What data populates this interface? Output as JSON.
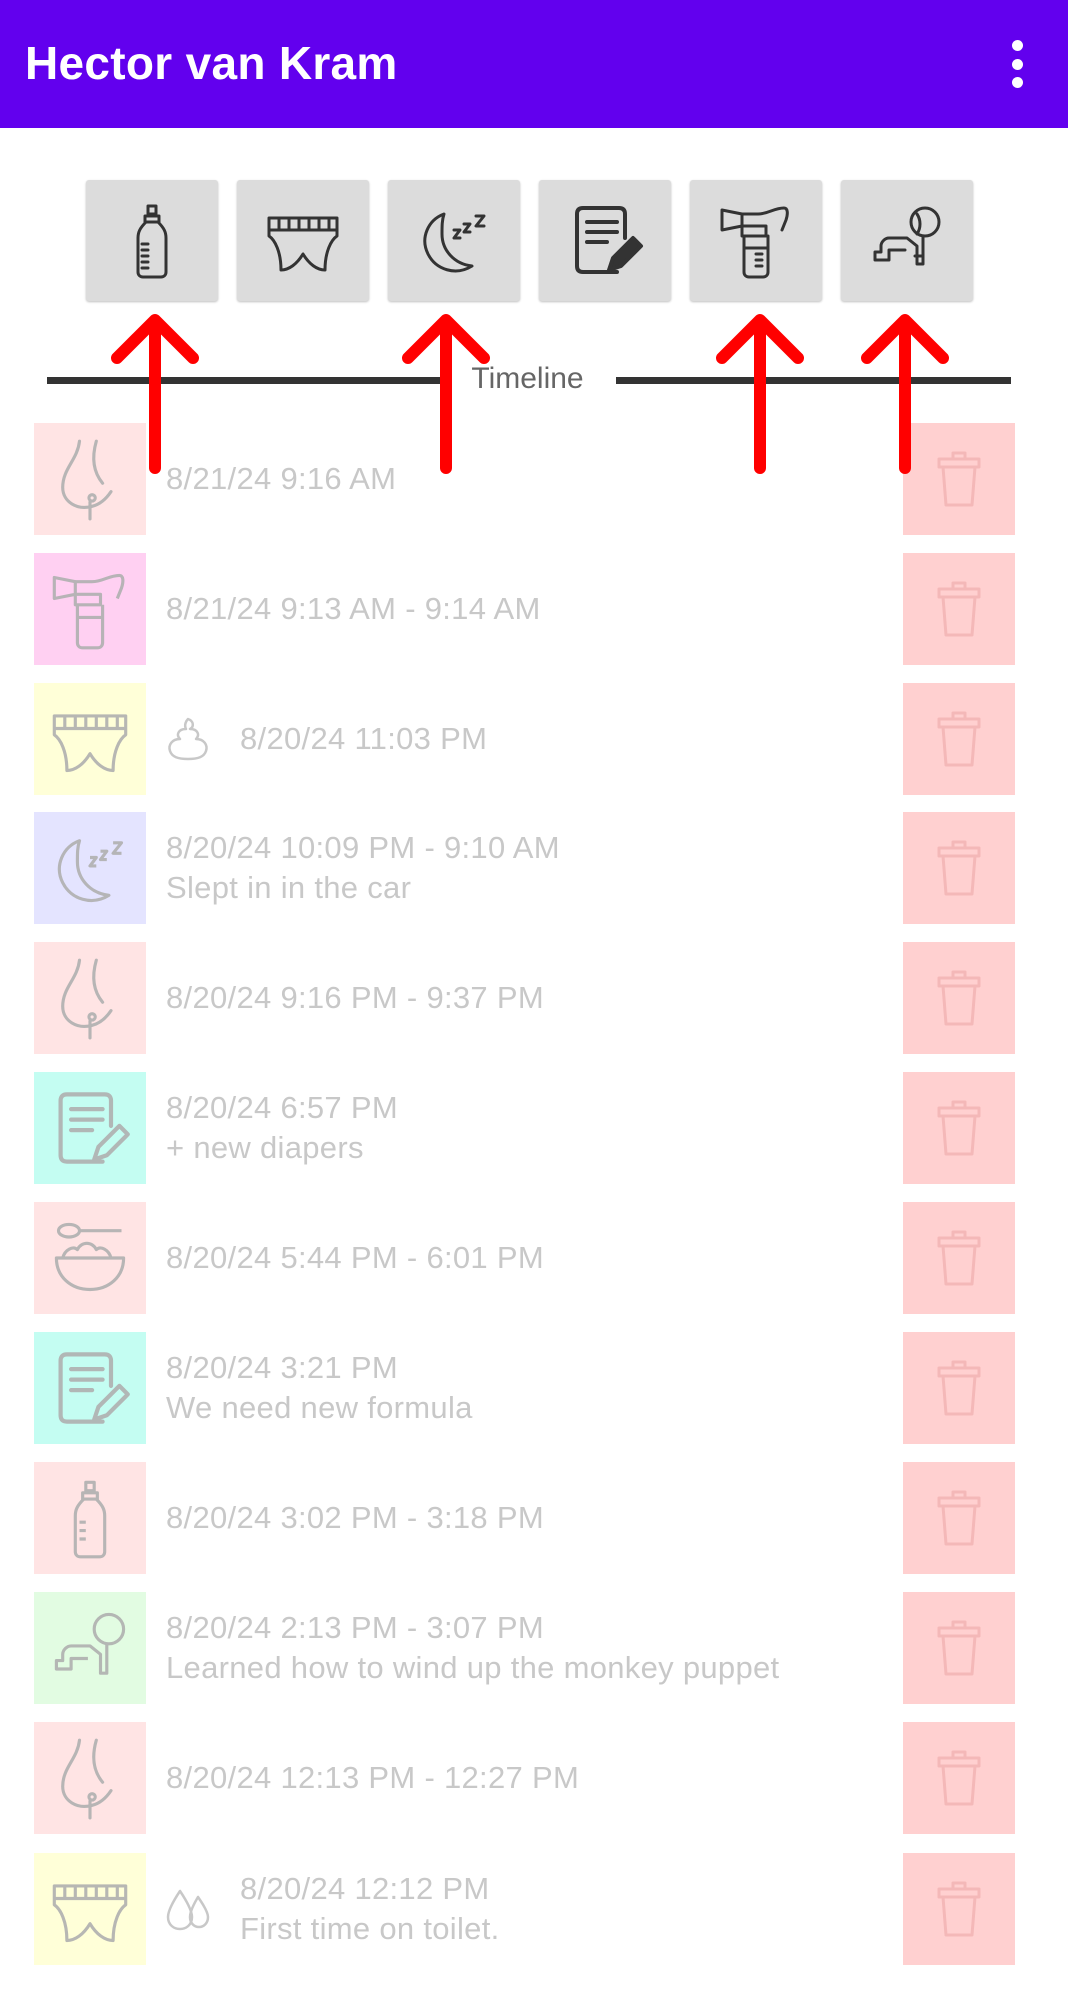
{
  "app_bar": {
    "title": "Hector van Kram",
    "menu_icon": "more-vert-icon",
    "color": "#6200EE"
  },
  "toolbar": {
    "buttons": [
      {
        "icon": "baby-bottle-icon"
      },
      {
        "icon": "diaper-icon"
      },
      {
        "icon": "sleep-moon-icon"
      },
      {
        "icon": "note-icon"
      },
      {
        "icon": "breast-pump-icon"
      },
      {
        "icon": "crawling-baby-icon"
      }
    ]
  },
  "timeline": {
    "label": "Timeline"
  },
  "entries": [
    {
      "type": "breastfeed",
      "bg": "#ffe4e4",
      "line1": "8/21/24  9:16 AM",
      "line2": ""
    },
    {
      "type": "pump",
      "bg": "#ffd0f2",
      "line1": "8/21/24  9:13 AM - 9:14 AM",
      "line2": ""
    },
    {
      "type": "diaper",
      "bg": "#ffffd8",
      "symbol": "poop-icon",
      "line1": "8/20/24  11:03 PM",
      "line2": ""
    },
    {
      "type": "sleep",
      "bg": "#e4e4ff",
      "line1": "8/20/24  10:09 PM - 9:10 AM",
      "line2": "Slept in in the car"
    },
    {
      "type": "breastfeed",
      "bg": "#ffe4e4",
      "line1": "8/20/24  9:16 PM - 9:37 PM",
      "line2": ""
    },
    {
      "type": "note",
      "bg": "#c4fdf2",
      "line1": "8/20/24  6:57 PM",
      "line2": "+ new diapers"
    },
    {
      "type": "solid-food",
      "bg": "#ffe4e4",
      "line1": "8/20/24  5:44 PM - 6:01 PM",
      "line2": ""
    },
    {
      "type": "note",
      "bg": "#c4fdf2",
      "line1": "8/20/24  3:21 PM",
      "line2": "We need new formula"
    },
    {
      "type": "bottle",
      "bg": "#ffe4e4",
      "line1": "8/20/24  3:02 PM - 3:18 PM",
      "line2": ""
    },
    {
      "type": "activity",
      "bg": "#e2fce2",
      "line1": "8/20/24  2:13 PM - 3:07 PM",
      "line2": "Learned how to wind up the monkey puppet"
    },
    {
      "type": "breastfeed",
      "bg": "#ffe4e4",
      "line1": "8/20/24  12:13 PM - 12:27 PM",
      "line2": ""
    },
    {
      "type": "diaper",
      "bg": "#ffffd8",
      "symbol": "pee-drops-icon",
      "line1": "8/20/24  12:12 PM",
      "line2": "First time on toilet."
    }
  ],
  "delete_icon": "trash-icon",
  "overlay": {
    "arrow_color": "#ff0000",
    "arrow_targets": [
      "baby-bottle-icon",
      "sleep-moon-icon",
      "breast-pump-icon",
      "crawling-baby-icon"
    ]
  }
}
